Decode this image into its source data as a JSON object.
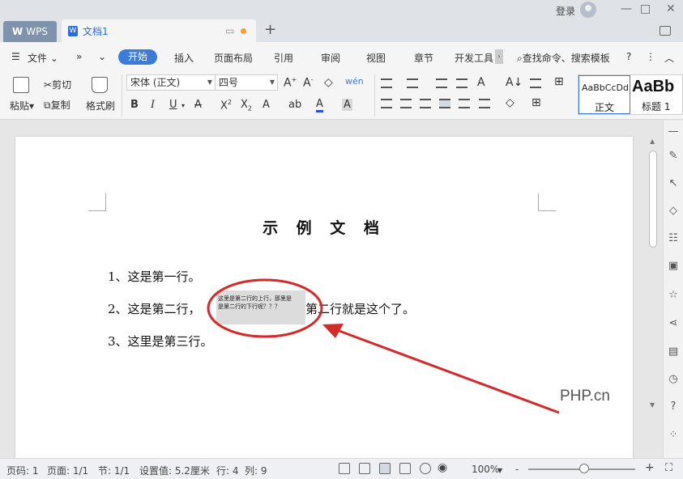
{
  "app": {
    "app_tab": "WPS",
    "doc_tab": "文档1",
    "new_tab": "+",
    "login": "登录"
  },
  "menu": {
    "file": "文件",
    "items": [
      "开始",
      "插入",
      "页面布局",
      "引用",
      "审阅",
      "视图",
      "章节",
      "开发工具"
    ],
    "search": "查找命令、搜索模板"
  },
  "ribbon": {
    "paste": "粘贴",
    "cut": "剪切",
    "copy": "复制",
    "format_painter": "格式刷",
    "font_name": "宋体 (正文)",
    "font_size": "四号",
    "bold": "B",
    "italic": "I",
    "underline": "U",
    "styles": [
      {
        "sample": "AaBbCcDd",
        "name": "正文"
      },
      {
        "sample": "AaBb",
        "name": "标题 1"
      }
    ]
  },
  "document": {
    "title": "示 例 文 档",
    "line1": "1、这是第一行。",
    "line2_before": "2、这是第二行，",
    "line2_after": "第二行就是这个了。",
    "inline_line1": "这里是第二行的上行，那里是",
    "inline_line2": "是第二行的下行呢？？？",
    "line3": "3、这里是第三行。",
    "watermark": "PHP.cn"
  },
  "status": {
    "page_no": "页码: 1",
    "pages": "页面: 1/1",
    "section": "节: 1/1",
    "setting": "设置值: 5.2厘米",
    "row": "行: 4",
    "col": "列: 9",
    "zoom": "100%",
    "zoom_minus": "-",
    "zoom_plus": "+"
  },
  "colors": {
    "accent": "#3b7cd8",
    "annotation": "#d42a2a"
  }
}
